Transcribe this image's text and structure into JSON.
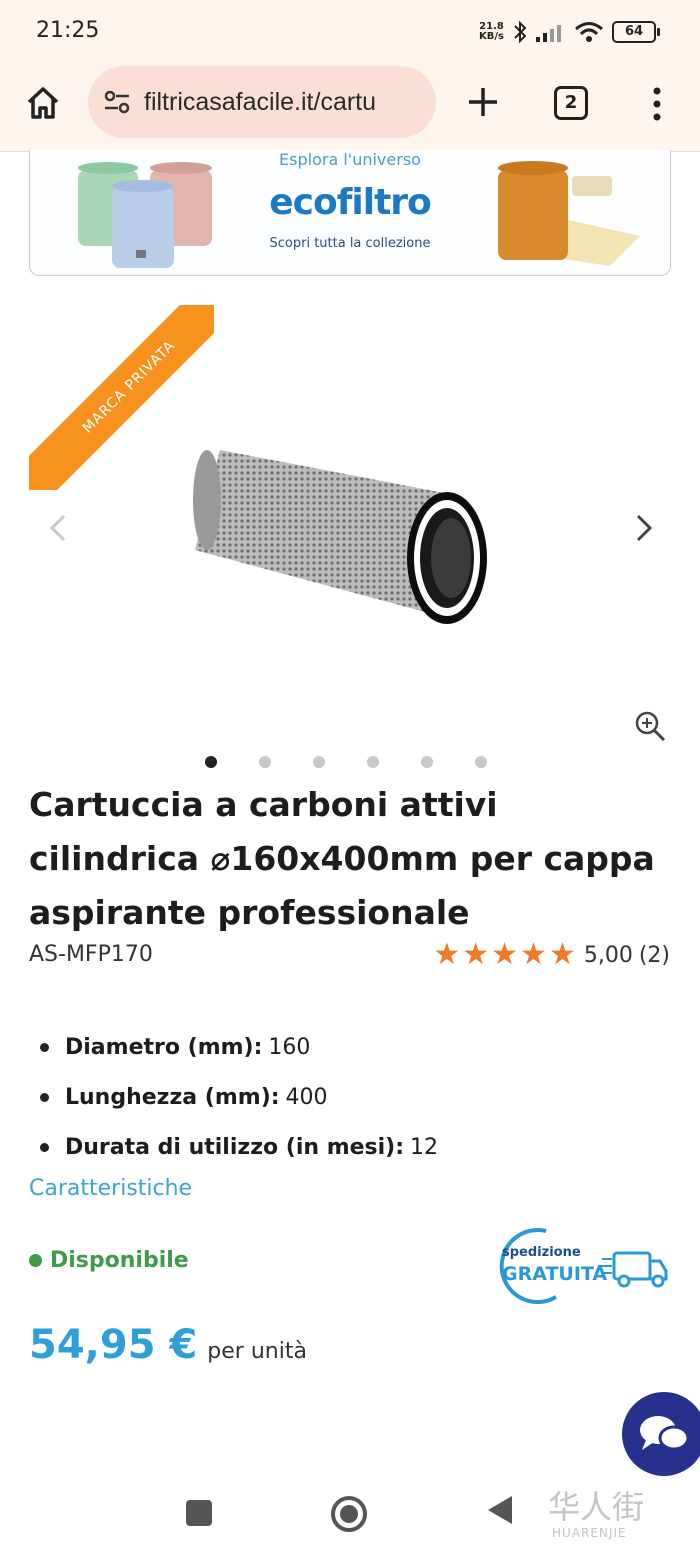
{
  "status": {
    "time": "21:25",
    "net_speed_value": "21.8",
    "net_speed_unit": "KB/s",
    "battery": "64"
  },
  "browser": {
    "url": "filtricasafacile.it/cartu",
    "tab_count": "2"
  },
  "banner": {
    "tagline": "Esplora l'universo",
    "logo": "ecofiltro",
    "subtitle": "Scopri tutta la collezione"
  },
  "product": {
    "ribbon": "MARCA PRIVATA",
    "title": "Cartuccia a carboni attivi cilindrica ⌀160x400mm per cappa aspirante professionale",
    "sku": "AS-MFP170",
    "rating_stars": 5,
    "rating_value": "5,00",
    "rating_count": "(2)",
    "carousel_pages": 6,
    "carousel_active": 1,
    "specs": [
      {
        "key": "Diametro (mm):",
        "value": "160"
      },
      {
        "key": "Lunghezza (mm):",
        "value": "400"
      },
      {
        "key": "Durata di utilizzo (in mesi):",
        "value": "12"
      }
    ],
    "features_link": "Caratteristiche",
    "availability": "Disponibile",
    "shipping_small": "spedizione",
    "shipping_big": "GRATUITA",
    "price": "54,95 €",
    "price_unit": "per unità"
  },
  "colors": {
    "accent_blue": "#2f9fd7",
    "ribbon_orange": "#f7921e",
    "star_orange": "#ee7a2a",
    "available_green": "#3f9a4a",
    "chat_navy": "#25318d"
  },
  "watermark": {
    "text": "华人街",
    "sub": "HUARENJIE"
  }
}
